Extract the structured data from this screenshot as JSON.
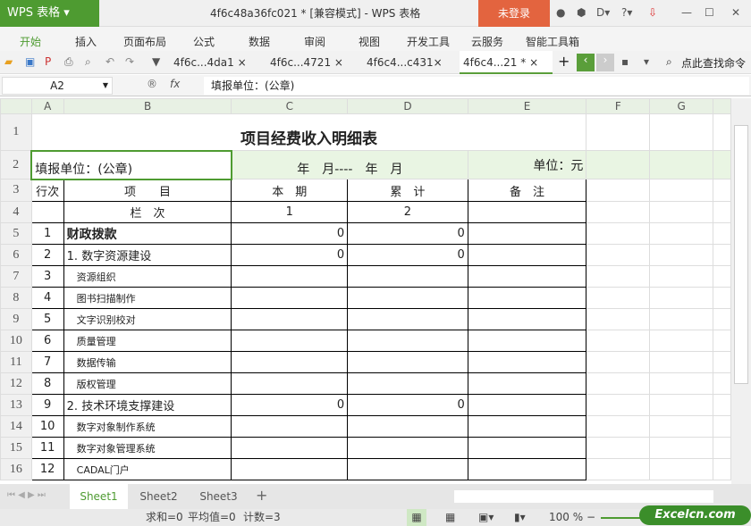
{
  "app": {
    "logo": "WPS 表格",
    "title": "4f6c48a36fc021 * [兼容模式] - WPS 表格",
    "login": "未登录"
  },
  "menu": [
    "开始",
    "插入",
    "页面布局",
    "公式",
    "数据",
    "审阅",
    "视图",
    "开发工具",
    "云服务",
    "智能工具箱"
  ],
  "doc_tabs": [
    "4f6c...4da1 ×",
    "4f6c...4721 ×",
    "4f6c4...c431×",
    "4f6c4...21 * ×"
  ],
  "search_cmd": "点此查找命令",
  "formula": {
    "cell": "A2",
    "fx": "fx",
    "value": "填报单位：(公章)"
  },
  "columns": [
    "A",
    "B",
    "C",
    "D",
    "E",
    "F",
    "G"
  ],
  "sheet": {
    "title": "项目经费收入明细表",
    "unit_label": "填报单位：(公章)",
    "date_label": "年　月----　年　月",
    "currency": "单位：元",
    "header": [
      "行次",
      "项　　目",
      "本　期",
      "累　计",
      "备　注"
    ],
    "subheader": [
      "",
      "栏　次",
      "1",
      "2",
      ""
    ],
    "rows": [
      {
        "n": "1",
        "name": "财政拨款",
        "c": "0",
        "d": "0",
        "bold": true
      },
      {
        "n": "2",
        "name": "1. 数字资源建设",
        "c": "0",
        "d": "0"
      },
      {
        "n": "3",
        "name": "资源组织",
        "c": "",
        "d": "",
        "sub": true
      },
      {
        "n": "4",
        "name": "图书扫描制作",
        "c": "",
        "d": "",
        "sub": true
      },
      {
        "n": "5",
        "name": "文字识别校对",
        "c": "",
        "d": "",
        "sub": true
      },
      {
        "n": "6",
        "name": "质量管理",
        "c": "",
        "d": "",
        "sub": true
      },
      {
        "n": "7",
        "name": "数据传输",
        "c": "",
        "d": "",
        "sub": true
      },
      {
        "n": "8",
        "name": "版权管理",
        "c": "",
        "d": "",
        "sub": true
      },
      {
        "n": "9",
        "name": "2. 技术环境支撑建设",
        "c": "0",
        "d": "0"
      },
      {
        "n": "10",
        "name": "数字对象制作系统",
        "c": "",
        "d": "",
        "sub": true
      },
      {
        "n": "11",
        "name": "数字对象管理系统",
        "c": "",
        "d": "",
        "sub": true
      },
      {
        "n": "12",
        "name": "CADAL门户",
        "c": "",
        "d": "",
        "sub": true
      }
    ]
  },
  "row_numbers": [
    "1",
    "2",
    "3",
    "4",
    "5",
    "6",
    "7",
    "8",
    "9",
    "10",
    "11",
    "12",
    "13",
    "14",
    "15",
    "16"
  ],
  "sheets": [
    "Sheet1",
    "Sheet2",
    "Sheet3"
  ],
  "status": {
    "sum": "求和=0",
    "avg": "平均值=0",
    "count": "计数=3",
    "zoom": "100 %"
  },
  "watermark": "Excelcn.com"
}
